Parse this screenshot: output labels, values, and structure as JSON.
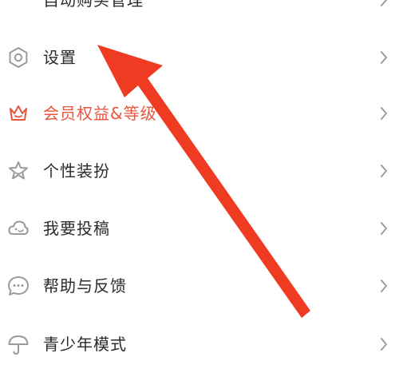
{
  "colors": {
    "accent": "#e8553c",
    "icon_gray": "#9a9a9a",
    "text_dark": "#2a2a2a",
    "chevron_gray": "#9d9d9d",
    "arrow_red": "#ef3b22"
  },
  "menu": {
    "items": [
      {
        "label": "自动购买管理",
        "icon": "auto-buy-icon"
      },
      {
        "label": "设置",
        "icon": "settings-hexagon-icon"
      },
      {
        "label": "会员权益&等级",
        "icon": "crown-icon"
      },
      {
        "label": "个性装扮",
        "icon": "star-theme-icon"
      },
      {
        "label": "我要投稿",
        "icon": "cloud-submit-icon"
      },
      {
        "label": "帮助与反馈",
        "icon": "chat-bubble-icon"
      },
      {
        "label": "青少年模式",
        "icon": "umbrella-icon"
      }
    ]
  },
  "annotation": {
    "type": "arrow",
    "target": "设置",
    "color": "#ef3b22"
  }
}
